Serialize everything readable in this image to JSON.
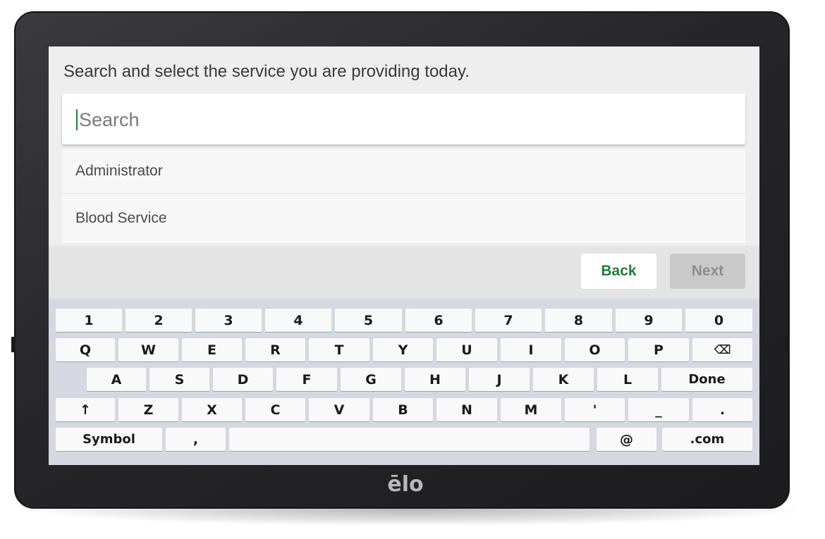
{
  "screen": {
    "instruction": "Search and select the service you are providing today.",
    "search": {
      "placeholder": "Search",
      "value": ""
    },
    "services": [
      "Administrator",
      "Blood Service"
    ],
    "back_label": "Back",
    "next_label": "Next"
  },
  "keyboard": {
    "rows": [
      [
        "1",
        "2",
        "3",
        "4",
        "5",
        "6",
        "7",
        "8",
        "9",
        "0"
      ],
      [
        "Q",
        "W",
        "E",
        "R",
        "T",
        "Y",
        "U",
        "I",
        "O",
        "P",
        "⌫"
      ],
      [
        "A",
        "S",
        "D",
        "F",
        "G",
        "H",
        "J",
        "K",
        "L",
        "Done"
      ],
      [
        "↑",
        "Z",
        "X",
        "C",
        "V",
        "B",
        "N",
        "M",
        "'",
        "_",
        "."
      ],
      [
        "Symbol",
        ",",
        " ",
        "@",
        ".com"
      ]
    ]
  },
  "device": {
    "logo_text": "ēlo"
  },
  "colors": {
    "accent": "#1e7d3e",
    "bezel": "#262628",
    "keyboard_bg": "#d5d8e0"
  }
}
